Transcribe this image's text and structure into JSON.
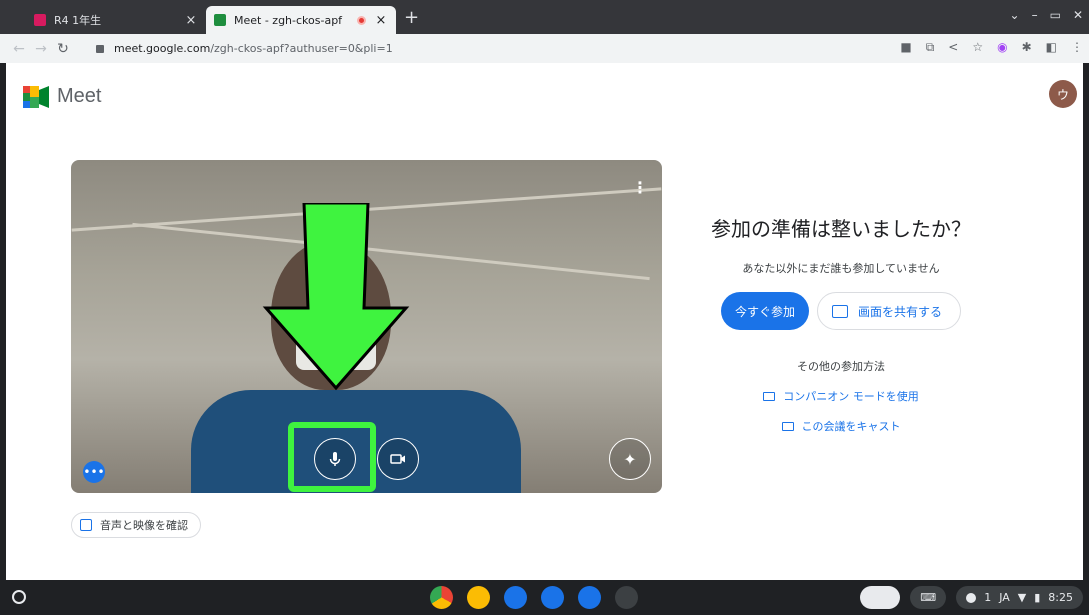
{
  "browser": {
    "tabs": [
      {
        "title": "R4  1年生",
        "active": false,
        "favicon_color": "#d81b60"
      },
      {
        "title": "Meet - zgh-ckos-apf",
        "active": true,
        "favicon_color": "#1e8e3e"
      }
    ],
    "close_glyph": "×",
    "new_tab_glyph": "+",
    "url_host": "meet.google.com",
    "url_path": "/zgh-ckos-apf?authuser=0&pli=1"
  },
  "page": {
    "app_name": "Meet",
    "avatar_initial": "ウ",
    "menu_glyph": "⋮",
    "effects_glyph": "✦",
    "more_glyph": "•••",
    "check_audio_video": "音声と映像を確認"
  },
  "join_panel": {
    "title": "参加の準備は整いましたか？",
    "subtitle": "あなた以外にまだ誰も参加していません",
    "join_now": "今すぐ参加",
    "present": "画面を共有する",
    "other_ways": "その他の参加方法",
    "companion_mode": "コンパニオン モードを使用",
    "cast": "この会議をキャスト"
  },
  "colors": {
    "accent": "#1a73e8",
    "annotation": "#3ff33f"
  },
  "shelf": {
    "status_lang": "JA",
    "clock": "8:25",
    "notification_count": "1",
    "apps": [
      "chrome-icon",
      "classroom-icon",
      "keep-icon",
      "camera-icon",
      "files-icon",
      "user-icon"
    ]
  }
}
